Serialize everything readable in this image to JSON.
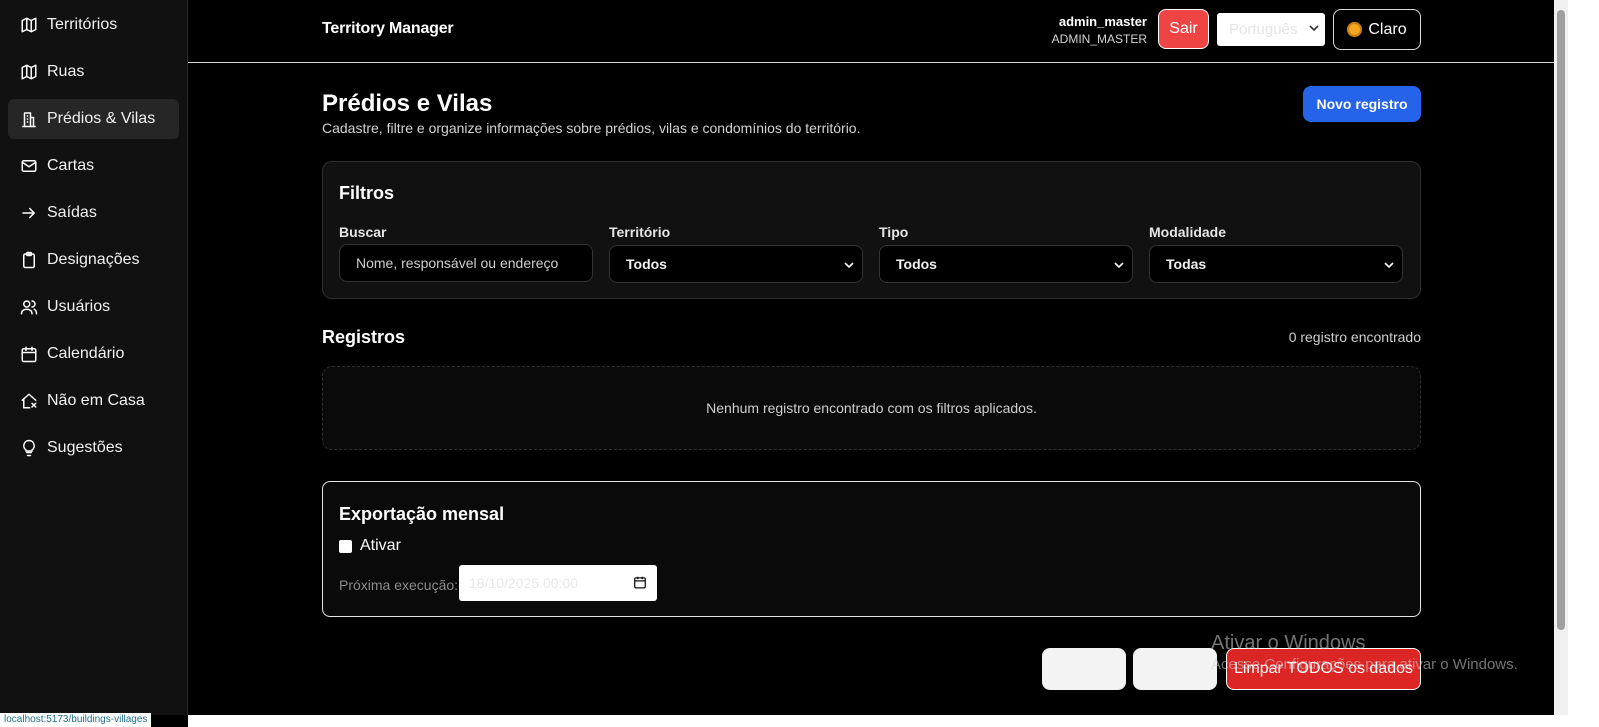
{
  "sidebar": {
    "items": [
      {
        "label": "Territórios",
        "icon": "map-icon"
      },
      {
        "label": "Ruas",
        "icon": "map-icon"
      },
      {
        "label": "Prédios & Vilas",
        "icon": "building-icon",
        "active": true
      },
      {
        "label": "Cartas",
        "icon": "mail-icon"
      },
      {
        "label": "Saídas",
        "icon": "arrow-right-icon"
      },
      {
        "label": "Designações",
        "icon": "clipboard-icon"
      },
      {
        "label": "Usuários",
        "icon": "users-icon"
      },
      {
        "label": "Calendário",
        "icon": "calendar-icon"
      },
      {
        "label": "Não em Casa",
        "icon": "house-x-icon"
      },
      {
        "label": "Sugestões",
        "icon": "lightbulb-icon"
      }
    ]
  },
  "status_url": "localhost:5173/buildings-villages",
  "header": {
    "brand": "Territory Manager",
    "user_name": "admin_master",
    "user_role": "ADMIN_MASTER",
    "logout_label": "Sair",
    "language_value": "Português",
    "theme_label": "Claro"
  },
  "page": {
    "title": "Prédios e Vilas",
    "subtitle": "Cadastre, filtre e organize informações sobre prédios, vilas e condomínios do território.",
    "new_button": "Novo registro"
  },
  "filters": {
    "title": "Filtros",
    "search_label": "Buscar",
    "search_placeholder": "Nome, responsável ou endereço",
    "territory_label": "Território",
    "territory_value": "Todos",
    "type_label": "Tipo",
    "type_value": "Todos",
    "mode_label": "Modalidade",
    "mode_value": "Todas"
  },
  "records": {
    "title": "Registros",
    "count_text": "0 registro encontrado",
    "empty_text": "Nenhum registro encontrado com os filtros aplicados."
  },
  "export": {
    "title": "Exportação mensal",
    "enable_label": "Ativar",
    "next_label": "Próxima execução:",
    "next_value": "18/10/2025 00:00"
  },
  "actions": {
    "clear_all": "Limpar TODOS os dados"
  },
  "watermark": {
    "title": "Ativar o Windows",
    "subtitle": "Acesse Configurações para ativar o Windows."
  },
  "colors": {
    "accent_blue": "#2563eb",
    "danger_red": "#ef4444",
    "background": "#000000",
    "sidebar_bg": "#111111"
  }
}
